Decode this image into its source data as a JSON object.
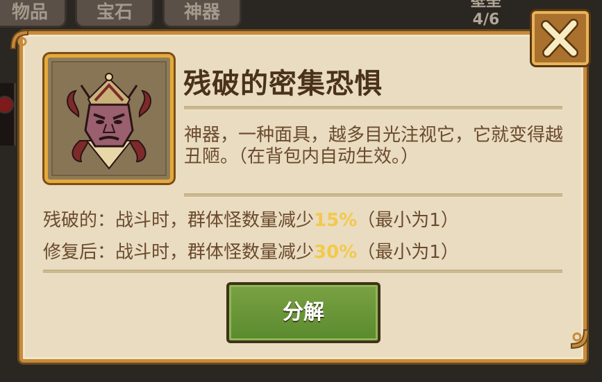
{
  "background": {
    "tabs": [
      "物品",
      "宝石",
      "神器"
    ],
    "progress_label": "壁垒",
    "progress_value": "4/6"
  },
  "dialog": {
    "item_name": "残破的密集恐惧",
    "description": "神器，一种面具，越多目光注视它，它就变得越丑陋。（在背包内自动生效。）",
    "effects": [
      {
        "prefix": "残破的：战斗时，群体怪数量减少",
        "value": "15%",
        "suffix": "（最小为1）"
      },
      {
        "prefix": "修复后：战斗时，群体怪数量减少",
        "value": "30%",
        "suffix": "（最小为1）"
      }
    ],
    "action_button": "分解",
    "close_icon": "close-x-icon",
    "portrait_icon": "demon-mask-icon"
  },
  "colors": {
    "panel": "#e9dcc0",
    "frame": "#c88a3a",
    "title": "#4a3218",
    "text": "#6b4a2e",
    "highlight": "#f2c94c",
    "button_green": "#6f9a3c"
  }
}
